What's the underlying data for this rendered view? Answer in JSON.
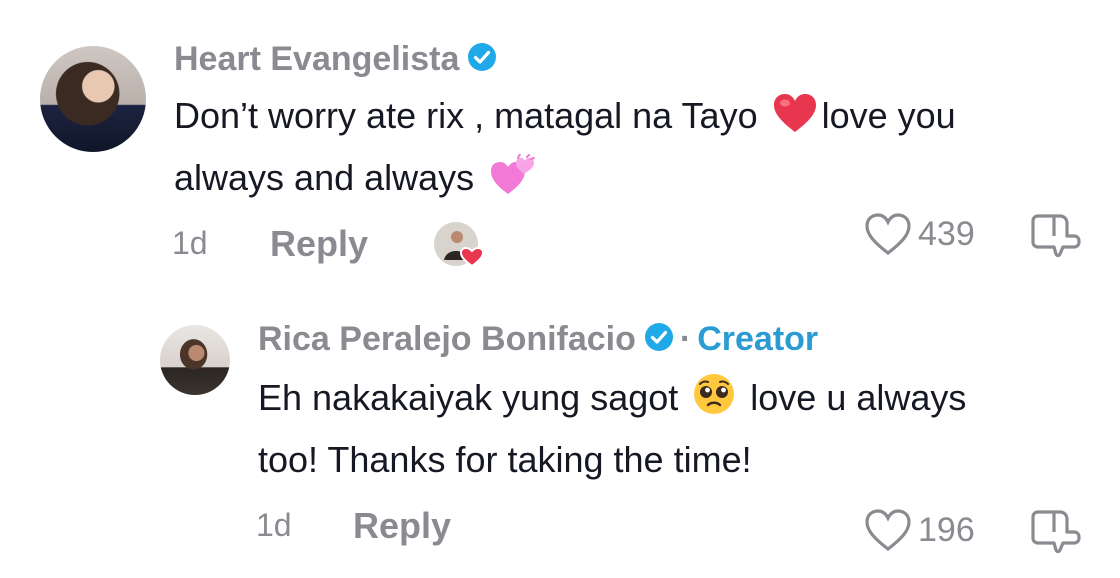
{
  "comments": [
    {
      "username": "Heart Evangelista",
      "line1_before_emoji": "Don’t worry ate rix , matagal na Tayo ",
      "line1_after_emoji": "love you",
      "line2": "always and always ",
      "emoji1": "red-heart-icon",
      "emoji2": "two-hearts-icon",
      "time": "1d",
      "reply_label": "Reply",
      "likes": "439"
    },
    {
      "username": "Rica Peralejo Bonifacio",
      "separator": "·",
      "badge": "Creator",
      "line1_before_emoji": "Eh nakakaiyak yung sagot ",
      "line1_after_emoji": " love u always",
      "line2": "too! Thanks for taking the time!",
      "emoji1": "pleading-face-icon",
      "time": "1d",
      "reply_label": "Reply",
      "likes": "196"
    }
  ],
  "colors": {
    "muted": "#8a8b91",
    "creator": "#2b9bd3",
    "verified": "#20a9e8",
    "heart": "#e8364f"
  }
}
